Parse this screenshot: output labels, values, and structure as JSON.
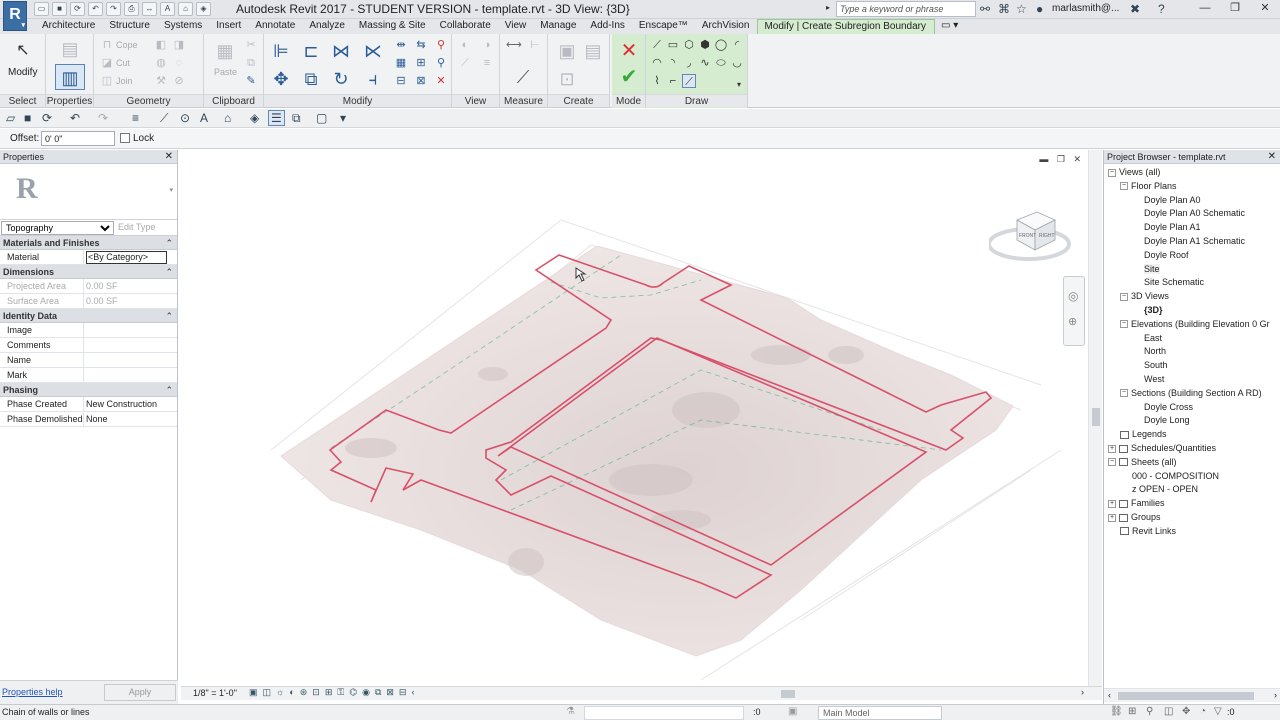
{
  "app": {
    "title": "Autodesk Revit 2017 - STUDENT VERSION -     template.rvt - 3D View: {3D}",
    "search_placeholder": "Type a keyword or phrase",
    "user": "marlasmith@...",
    "logo": "R"
  },
  "tabs": [
    "Architecture",
    "Structure",
    "Systems",
    "Insert",
    "Annotate",
    "Analyze",
    "Massing & Site",
    "Collaborate",
    "View",
    "Manage",
    "Add-Ins",
    "Enscape™",
    "ArchVision",
    "Modify | Create Subregion Boundary"
  ],
  "active_tab": "Modify | Create Subregion Boundary",
  "ribbon": {
    "modify": "Modify",
    "geometry_items": [
      "Cope",
      "Cut",
      "Join"
    ],
    "paste": "Paste",
    "panels": [
      "Select",
      "Properties",
      "Geometry",
      "Clipboard",
      "Modify",
      "View",
      "Measure",
      "Create",
      "Mode",
      "Draw"
    ]
  },
  "options": {
    "offset_label": "Offset:",
    "offset_value": "0'  0\"",
    "lock_label": "Lock"
  },
  "properties": {
    "title": "Properties",
    "type_selector": "Topography",
    "edit_type": "Edit Type",
    "groups": [
      {
        "name": "Materials and Finishes",
        "rows": [
          {
            "k": "Material",
            "v": "<By Category>",
            "box": true
          }
        ]
      },
      {
        "name": "Dimensions",
        "rows": [
          {
            "k": "Projected Area",
            "v": "0.00 SF",
            "grey": true
          },
          {
            "k": "Surface Area",
            "v": "0.00 SF",
            "grey": true
          }
        ]
      },
      {
        "name": "Identity Data",
        "rows": [
          {
            "k": "Image",
            "v": ""
          },
          {
            "k": "Comments",
            "v": ""
          },
          {
            "k": "Name",
            "v": ""
          },
          {
            "k": "Mark",
            "v": ""
          }
        ]
      },
      {
        "name": "Phasing",
        "rows": [
          {
            "k": "Phase Created",
            "v": "New Construction"
          },
          {
            "k": "Phase Demolished",
            "v": "None"
          }
        ]
      }
    ],
    "help_link": "Properties help",
    "apply": "Apply"
  },
  "viewport": {
    "scale": "1/8\" = 1'-0\"",
    "cube_front": "FRONT",
    "cube_right": "RIGHT"
  },
  "browser": {
    "title": "Project Browser - template.rvt",
    "items": [
      {
        "label": "Views (all)",
        "level": 0,
        "toggle": "−"
      },
      {
        "label": "Floor Plans",
        "level": 1,
        "toggle": "−"
      },
      {
        "label": "Doyle Plan A0",
        "level": 2
      },
      {
        "label": "Doyle Plan A0 Schematic",
        "level": 2
      },
      {
        "label": "Doyle Plan A1",
        "level": 2
      },
      {
        "label": "Doyle Plan A1 Schematic",
        "level": 2
      },
      {
        "label": "Doyle Roof",
        "level": 2
      },
      {
        "label": "Site",
        "level": 2,
        "selected": true
      },
      {
        "label": "Site Schematic",
        "level": 2
      },
      {
        "label": "3D Views",
        "level": 1,
        "toggle": "−"
      },
      {
        "label": "{3D}",
        "level": 2,
        "bold": true
      },
      {
        "label": "Elevations (Building Elevation 0 Gr",
        "level": 1,
        "toggle": "−"
      },
      {
        "label": "East",
        "level": 2
      },
      {
        "label": "North",
        "level": 2
      },
      {
        "label": "South",
        "level": 2
      },
      {
        "label": "West",
        "level": 2
      },
      {
        "label": "Sections (Building Section A RD)",
        "level": 1,
        "toggle": "−"
      },
      {
        "label": "Doyle Cross",
        "level": 2
      },
      {
        "label": "Doyle Long",
        "level": 2
      },
      {
        "label": "Legends",
        "level": 0,
        "icon": true
      },
      {
        "label": "Schedules/Quantities",
        "level": 0,
        "toggle": "+",
        "icon": true
      },
      {
        "label": "Sheets (all)",
        "level": 0,
        "toggle": "−",
        "icon": true
      },
      {
        "label": "000 - COMPOSITION",
        "level": 1
      },
      {
        "label": "z OPEN - OPEN",
        "level": 1
      },
      {
        "label": "Families",
        "level": 0,
        "toggle": "+",
        "icon": true
      },
      {
        "label": "Groups",
        "level": 0,
        "toggle": "+",
        "icon": true
      },
      {
        "label": "Revit Links",
        "level": 0,
        "icon": true
      }
    ]
  },
  "status": {
    "text": "Chain of walls or lines",
    "count": ":0",
    "model": "Main Model",
    "filter": ":0"
  },
  "colors": {
    "ribbon_accent": "#d6ecd1",
    "boundary": "#d8506a",
    "terrain": "#e9dedd"
  }
}
